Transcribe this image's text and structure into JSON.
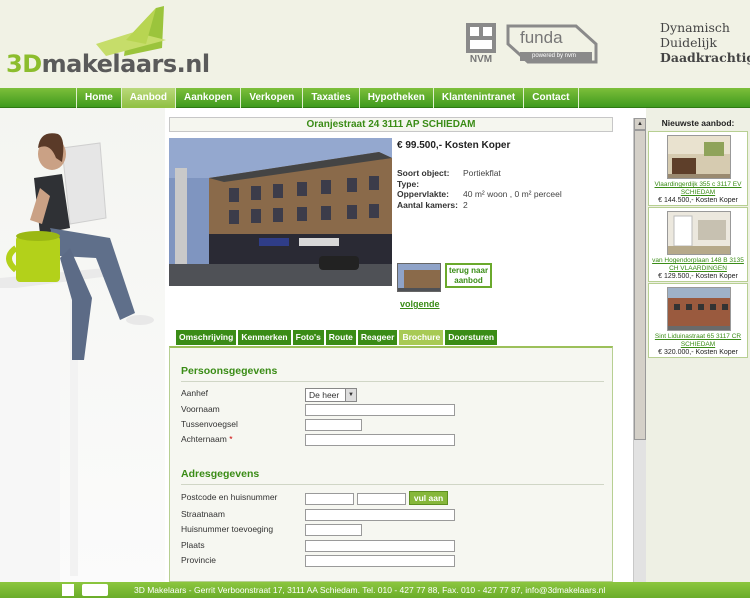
{
  "header": {
    "logo_text": "3Dmakelaars.nl",
    "logo_prefix": "3D",
    "logo_suffix": "makelaars.nl",
    "nvm_label": "NVM",
    "funda_label": "funda",
    "funda_sub": "powered by nvm",
    "tagline": [
      "Dynamisch",
      "Duidelijk",
      "Daadkrachtig"
    ]
  },
  "nav": [
    "Home",
    "Aanbod",
    "Aankopen",
    "Verkopen",
    "Taxaties",
    "Hypotheken",
    "Klantenintranet",
    "Contact"
  ],
  "nav_active": "Aanbod",
  "property": {
    "address": "Oranjestraat 24 3111 AP SCHIEDAM",
    "price": "€ 99.500,- Kosten Koper",
    "specs": [
      {
        "label": "Soort object:",
        "value": "Portiekflat"
      },
      {
        "label": "Type:",
        "value": ""
      },
      {
        "label": "Oppervlakte:",
        "value": "40 m² woon , 0 m² perceel"
      },
      {
        "label": "Aantal kamers:",
        "value": "2"
      }
    ],
    "back_button": "terug naar aanbod",
    "next_link": "volgende"
  },
  "tabs": [
    "Omschrijving",
    "Kenmerken",
    "Foto's",
    "Route",
    "Reageer",
    "Brochure",
    "Doorsturen"
  ],
  "tab_active": "Brochure",
  "form": {
    "section1": "Persoonsgegevens",
    "aanhef_label": "Aanhef",
    "aanhef_value": "De heer",
    "voornaam_label": "Voornaam",
    "tussenvoegsel_label": "Tussenvoegsel",
    "achternaam_label": "Achternaam",
    "required_mark": "*",
    "section2": "Adresgegevens",
    "postcode_label": "Postcode en huisnummer",
    "lookup_button": "vul aan",
    "straatnaam_label": "Straatnaam",
    "huisnummer_label": "Huisnummer toevoeging",
    "plaats_label": "Plaats",
    "provincie_label": "Provincie"
  },
  "sidebar": {
    "title": "Nieuwste aanbod:",
    "listings": [
      {
        "address": "Vlaardingerdijk 355 c 3117 EV SCHIEDAM",
        "price": "€ 144.500,- Kosten Koper"
      },
      {
        "address": "van Hogendorplaan 148 B 3135 CH VLAARDINGEN",
        "price": "€ 129.500,- Kosten Koper"
      },
      {
        "address": "Sint Liduinastraat 65 3117 CR SCHIEDAM",
        "price": "€ 320.000,- Kosten Koper"
      }
    ]
  },
  "footer": {
    "text": "3D Makelaars - Gerrit Verboonstraat 17, 3111 AA Schiedam.   Tel. 010 - 427 77 88,   Fax. 010 - 427 77 87,   info@3dmakelaars.nl"
  },
  "colors": {
    "brand_green": "#3a8c16",
    "nav_green": "#5aaa28",
    "accent_lime": "#a8ca55",
    "header_bg": "#f1f2e5"
  }
}
